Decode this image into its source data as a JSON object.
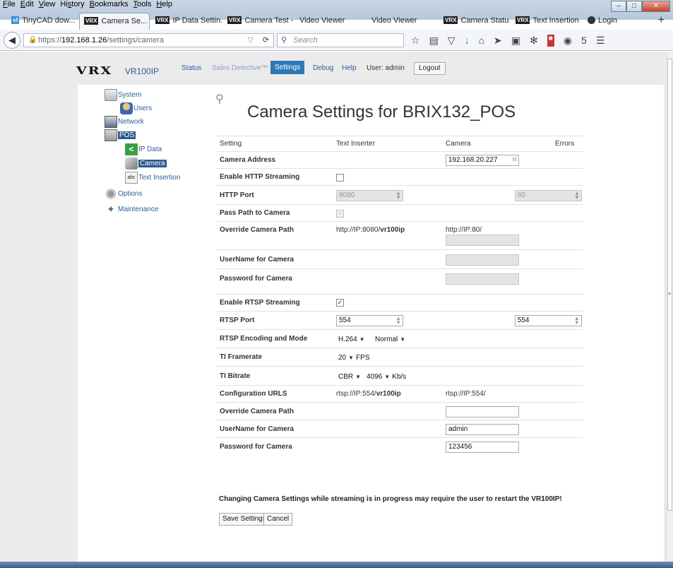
{
  "menu": {
    "items": [
      "File",
      "Edit",
      "View",
      "History",
      "Bookmarks",
      "Tools",
      "Help"
    ],
    "underlines": [
      "F",
      "E",
      "V",
      "s",
      "B",
      "T",
      "H"
    ]
  },
  "tabs": [
    {
      "label": "TinyCAD dow...",
      "icon": "sf"
    },
    {
      "label": "Camera Se...",
      "icon": "vrx",
      "active": true,
      "close": "×"
    },
    {
      "label": "IP Data Settin...",
      "icon": "vrx"
    },
    {
      "label": "Camera Test -...",
      "icon": "vrx"
    },
    {
      "label": "Video Viewer",
      "icon": ""
    },
    {
      "label": "Video Viewer",
      "icon": ""
    },
    {
      "label": "Camera Statu...",
      "icon": "vrx"
    },
    {
      "label": "Text Insertion ...",
      "icon": "vrx"
    },
    {
      "label": "Login",
      "icon": "login"
    }
  ],
  "new_tab": "+",
  "url": {
    "prefix": "https://",
    "host": "192.168.1.26",
    "path": "/settings/camera"
  },
  "search": {
    "placeholder": "Search"
  },
  "toolbar_badge": "5",
  "app": {
    "logo": "VRX",
    "model": "VR100IP",
    "nav": {
      "status": "Status",
      "sales": "Sales Detective™",
      "settings": "Settings",
      "debug": "Debug",
      "help": "Help",
      "user": "User: admin",
      "logout": "Logout"
    }
  },
  "sidebar": {
    "system": "System",
    "users": "Users",
    "network": "Network",
    "pos": "POS",
    "ipdata": "IP Data",
    "camera": "Camera",
    "text_insertion": "Text Insertion",
    "options": "Options",
    "maintenance": "Maintenance",
    "abc": "abc"
  },
  "title": "Camera Settings for BRIX132_POS",
  "table": {
    "headers": {
      "setting": "Setting",
      "inserter": "Text Inserter",
      "camera": "Camera",
      "errors": "Errors"
    },
    "camera_address": {
      "label": "Camera Address",
      "value": "192.168.20.227"
    },
    "http_streaming": {
      "label": "Enable HTTP Streaming"
    },
    "http_port": {
      "label": "HTTP Port",
      "inserter": "8080",
      "camera": "80"
    },
    "pass_path": {
      "label": "Pass Path to Camera"
    },
    "override_path1": {
      "label": "Override Camera Path",
      "inserter_pre": "http://IP:8080/",
      "inserter_bold": "vr100ip",
      "camera": "http://IP:80/"
    },
    "username1": {
      "label": "UserName for Camera"
    },
    "password1": {
      "label": "Password for Camera"
    },
    "rtsp_streaming": {
      "label": "Enable RTSP Streaming"
    },
    "rtsp_port": {
      "label": "RTSP Port",
      "inserter": "554",
      "camera": "554"
    },
    "rtsp_mode": {
      "label": "RTSP Encoding and Mode",
      "encoding": "H.264",
      "mode": "Normal"
    },
    "framerate": {
      "label": "TI Framerate",
      "value": "20",
      "unit": "FPS"
    },
    "bitrate": {
      "label": "TI Bitrate",
      "mode": "CBR",
      "value": "4096",
      "unit": "Kb/s"
    },
    "config_urls": {
      "label": "Configuration URLS",
      "inserter_pre": "rtsp://IP:554/",
      "inserter_bold": "vr100ip",
      "camera": "rtsp://IP:554/"
    },
    "override_path2": {
      "label": "Override Camera Path"
    },
    "username2": {
      "label": "UserName for Camera",
      "value": "admin"
    },
    "password2": {
      "label": "Password for Camera",
      "value": "123456"
    }
  },
  "warning": "Changing Camera Settings while streaming is in progress may require the user to restart the VR100IP!",
  "buttons": {
    "save": "Save Settings",
    "cancel": "Cancel"
  }
}
